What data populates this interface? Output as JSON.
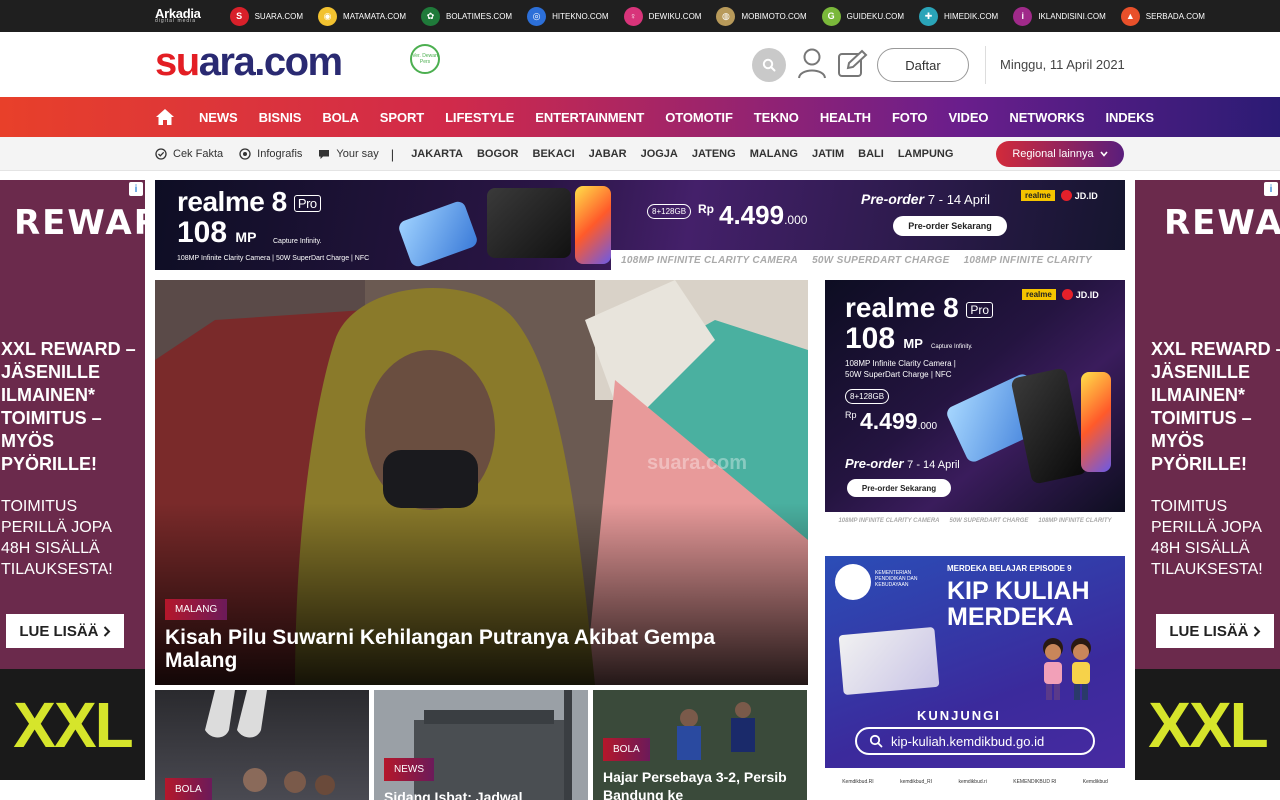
{
  "network": {
    "brand": "Arkadia",
    "brand_sub": "digital media",
    "sites": [
      {
        "name": "SUARA.COM",
        "icon": "S",
        "color": "#d8202a"
      },
      {
        "name": "MATAMATA.COM",
        "icon": "◉",
        "color": "#f2c230"
      },
      {
        "name": "BOLATIMES.COM",
        "icon": "✿",
        "color": "#1f7a3a"
      },
      {
        "name": "HITEKNO.COM",
        "icon": "◎",
        "color": "#2c6fd8"
      },
      {
        "name": "DEWIKU.COM",
        "icon": "♀",
        "color": "#d8347a"
      },
      {
        "name": "MOBIMOTO.COM",
        "icon": "◍",
        "color": "#b89a5a"
      },
      {
        "name": "GUIDEKU.COM",
        "icon": "G",
        "color": "#7ab83a"
      },
      {
        "name": "HIMEDIK.COM",
        "icon": "✚",
        "color": "#2aa4b8"
      },
      {
        "name": "IKLANDISINI.COM",
        "icon": "i",
        "color": "#a02a8a"
      },
      {
        "name": "SERBADA.COM",
        "icon": "▲",
        "color": "#e8502a"
      }
    ]
  },
  "header": {
    "logo_s": "su",
    "logo_rest": "ara.com",
    "badge": "Ver. Dewan Pers",
    "register_label": "Daftar",
    "date": "Minggu, 11 April 2021"
  },
  "nav": {
    "items": [
      "NEWS",
      "BISNIS",
      "BOLA",
      "SPORT",
      "LIFESTYLE",
      "ENTERTAINMENT",
      "OTOMOTIF",
      "TEKNO",
      "HEALTH",
      "FOTO",
      "VIDEO",
      "NETWORKS",
      "INDEKS"
    ]
  },
  "subnav": {
    "links": [
      {
        "label": "Cek Fakta",
        "icon": "check-circle-icon"
      },
      {
        "label": "Infografis",
        "icon": "target-icon"
      },
      {
        "label": "Your say",
        "icon": "speech-bubble-icon"
      }
    ],
    "divider": "|",
    "regions": [
      "JAKARTA",
      "BOGOR",
      "BEKACI",
      "JABAR",
      "JOGJA",
      "JATENG",
      "MALANG",
      "JATIM",
      "BALI",
      "LAMPUNG"
    ],
    "regional_button": "Regional lainnya"
  },
  "side_ad": {
    "info": "i",
    "brand": "REWARD",
    "headline": "XXL REWARD –JÄSENILLE ILMAINEN* TOIMITUS – MYÖS PYÖRILLE!",
    "sub": "TOIMITUS PERILLÄ JOPA 48H SISÄLLÄ TILAUKSESTA!",
    "cta": "LUE LISÄÄ",
    "logo": "XXL"
  },
  "banner_top": {
    "brand": "realme 8",
    "pro": "Pro",
    "mp": "108",
    "mp_unit": "MP",
    "capture": "Capture Infinity.",
    "spec": "108MP Infinite Clarity Camera | 50W SuperDart Charge | NFC",
    "ram": "8+128GB",
    "rp": "Rp",
    "price": "4.499",
    "price_tail": ".000",
    "preorder": "Pre-order",
    "dates": "7 - 14 April",
    "cta": "Pre-order Sekarang",
    "realme_logo": "realme",
    "jd": "JD.ID",
    "strip": [
      "108MP INFINITE CLARITY CAMERA",
      "50W SUPERDART CHARGE",
      "108MP INFINITE CLARITY"
    ]
  },
  "hero": {
    "label": "MALANG",
    "title": "Kisah Pilu Suwarni Kehilangan Putranya Akibat Gempa Malang",
    "watermark": "suara.com"
  },
  "ad_right": {
    "brand": "realme 8",
    "pro": "Pro",
    "mp": "108",
    "mp_unit": "MP",
    "capture": "Capture Infinity.",
    "spec1": "108MP Infinite Clarity Camera |",
    "spec2": "50W SuperDart Charge | NFC",
    "ram": "8+128GB",
    "rp": "Rp",
    "price": "4.499",
    "price_tail": ".000",
    "preorder": "Pre-order",
    "dates": "7 - 14 April",
    "cta": "Pre-order Sekarang",
    "realme_logo": "realme",
    "jd": "JD.ID",
    "strip": [
      "108MP INFINITE CLARITY CAMERA",
      "50W SUPERDART CHARGE",
      "108MP INFINITE CLARITY"
    ]
  },
  "ad_kip": {
    "episode": "MERDEKA BELAJAR EPISODE 9",
    "ministry": "KEMENTERIAN PENDIDIKAN DAN KEBUDAYAAN",
    "title": "KIP KULIAH MERDEKA",
    "visit": "KUNJUNGI",
    "url": "kip-kuliah.kemdikbud.go.id",
    "footer": [
      "Kemdikbud.RI",
      "kemdikbud_RI",
      "kemdikbud.ri",
      "KEMENDIKBUD RI",
      "Kemdikbud"
    ]
  },
  "cards": [
    {
      "label": "BOLA",
      "title": ""
    },
    {
      "label": "NEWS",
      "title": "Sidang Isbat: Jadwal"
    },
    {
      "label": "BOLA",
      "title": "Hajar Persebaya 3-2, Persib Bandung ke"
    }
  ],
  "colors": {
    "brand_red": "#e31e24",
    "brand_navy": "#2a2a72",
    "nav_gradient_start": "#e8402a",
    "nav_gradient_end": "#2b1b74"
  }
}
